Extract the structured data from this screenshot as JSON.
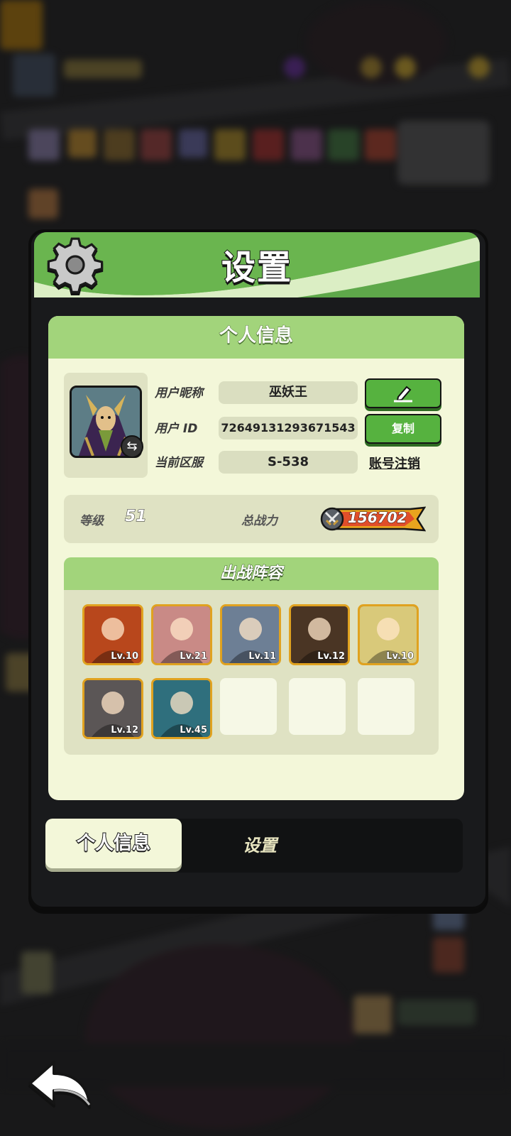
{
  "panel": {
    "title": "设置"
  },
  "profile": {
    "section_title": "个人信息",
    "nickname_label": "用户昵称",
    "nickname": "巫妖王",
    "id_label": "用户 ID",
    "user_id": "72649131293671543",
    "server_label": "当前区服",
    "server": "S-538",
    "copy_button": "复制",
    "deactivate_link": "账号注销",
    "level_label": "等级",
    "level": "51",
    "power_label": "总战力",
    "power": "156702"
  },
  "lineup": {
    "title": "出战阵容",
    "heroes": [
      {
        "level": "Lv.10",
        "color": "#b8471c"
      },
      {
        "level": "Lv.21",
        "color": "#c98a86"
      },
      {
        "level": "Lv.11",
        "color": "#6d7f95"
      },
      {
        "level": "Lv.12",
        "color": "#4a3524"
      },
      {
        "level": "Lv.10",
        "color": "#d9c97a"
      },
      {
        "level": "Lv.12",
        "color": "#5b5656"
      },
      {
        "level": "Lv.45",
        "color": "#2f6f7d"
      }
    ],
    "empty_slots": 3
  },
  "tabs": {
    "active": "个人信息",
    "inactive": "设置"
  },
  "colors": {
    "header_green": "#5ea84a",
    "card_bg": "#f3f7d9",
    "button_green": "#56b23f",
    "hero_border": "#e0a21f"
  },
  "icons": {
    "settings": "gear-icon",
    "edit": "pencil-icon",
    "swap": "swap-arrows-icon",
    "power": "crossed-swords-icon",
    "back": "back-arrow-icon"
  }
}
